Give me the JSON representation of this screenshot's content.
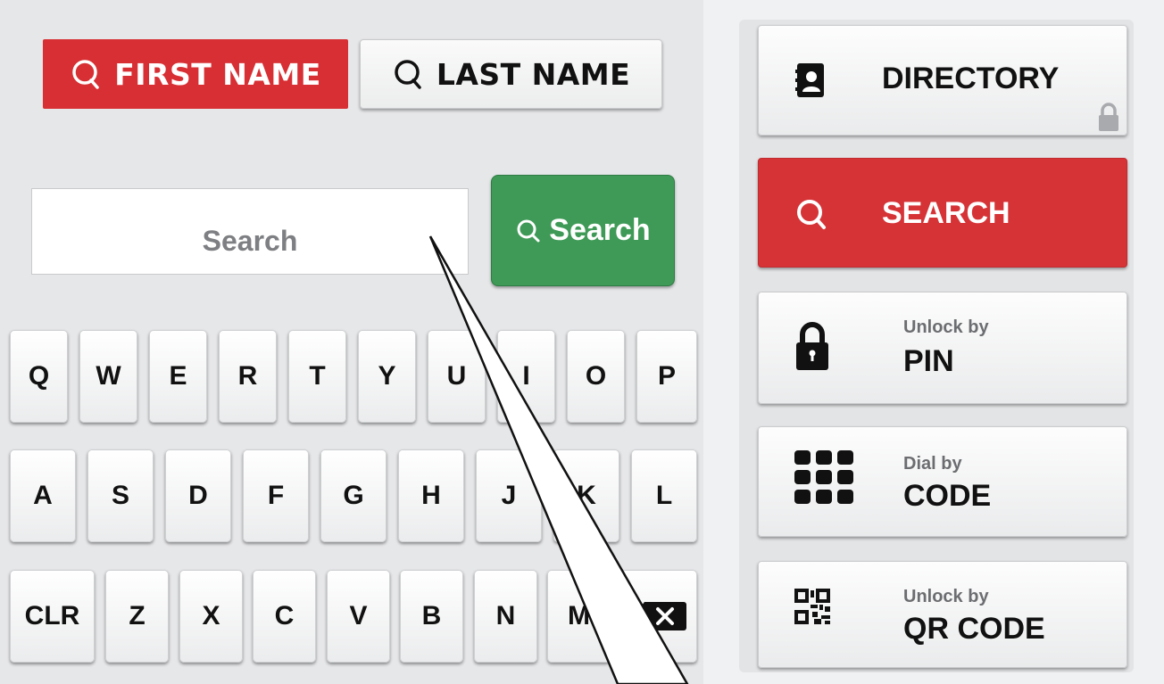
{
  "name_mode": {
    "first_label": "FIRST NAME",
    "last_label": "LAST NAME"
  },
  "search": {
    "placeholder": "Search",
    "button_label": "Search"
  },
  "keyboard": {
    "row1": [
      "Q",
      "W",
      "E",
      "R",
      "T",
      "Y",
      "U",
      "I",
      "O",
      "P"
    ],
    "row2": [
      "A",
      "S",
      "D",
      "F",
      "G",
      "H",
      "J",
      "K",
      "L"
    ],
    "row3": [
      "CLR",
      "Z",
      "X",
      "C",
      "V",
      "B",
      "N",
      "M"
    ],
    "backspace_icon": "backspace-icon"
  },
  "sidebar": {
    "directory_label": "DIRECTORY",
    "search_label": "SEARCH",
    "pin": {
      "sub": "Unlock by",
      "main": "PIN"
    },
    "code": {
      "sub": "Dial by",
      "main": "CODE"
    },
    "qr": {
      "sub": "Unlock by",
      "main": "QR CODE"
    }
  },
  "colors": {
    "accent_red": "#d72f33",
    "search_green": "#3f9a57",
    "background": "#e6e7e9"
  }
}
